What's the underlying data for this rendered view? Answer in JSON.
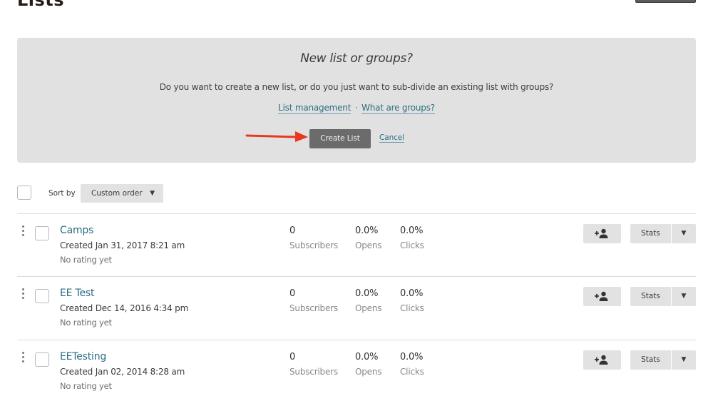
{
  "header": {
    "title": "Lists"
  },
  "notice": {
    "title": "New list or groups?",
    "text": "Do you want to create a new list, or do you just want to sub-divide an existing list with groups?",
    "link_list_management": "List management",
    "separator": "·",
    "link_groups": "What are groups?",
    "create_button": "Create List",
    "cancel_link": "Cancel",
    "arrow_color": "#e8381e"
  },
  "toolbar": {
    "sort_label": "Sort by",
    "sort_value": "Custom order",
    "chevron": "⌄"
  },
  "lists": [
    {
      "name": "Camps",
      "created": "Created Jan 31, 2017 8:21 am",
      "rating": "No rating yet",
      "subscribers": "0",
      "subscribers_label": "Subscribers",
      "opens": "0.0%",
      "opens_label": "Opens",
      "clicks": "0.0%",
      "clicks_label": "Clicks",
      "stats_label": "Stats"
    },
    {
      "name": "EE Test",
      "created": "Created Dec 14, 2016 4:34 pm",
      "rating": "No rating yet",
      "subscribers": "0",
      "subscribers_label": "Subscribers",
      "opens": "0.0%",
      "opens_label": "Opens",
      "clicks": "0.0%",
      "clicks_label": "Clicks",
      "stats_label": "Stats"
    },
    {
      "name": "EETesting",
      "created": "Created Jan 02, 2014 8:28 am",
      "rating": "No rating yet",
      "subscribers": "0",
      "subscribers_label": "Subscribers",
      "opens": "0.0%",
      "opens_label": "Opens",
      "clicks": "0.0%",
      "clicks_label": "Clicks",
      "stats_label": "Stats"
    }
  ]
}
